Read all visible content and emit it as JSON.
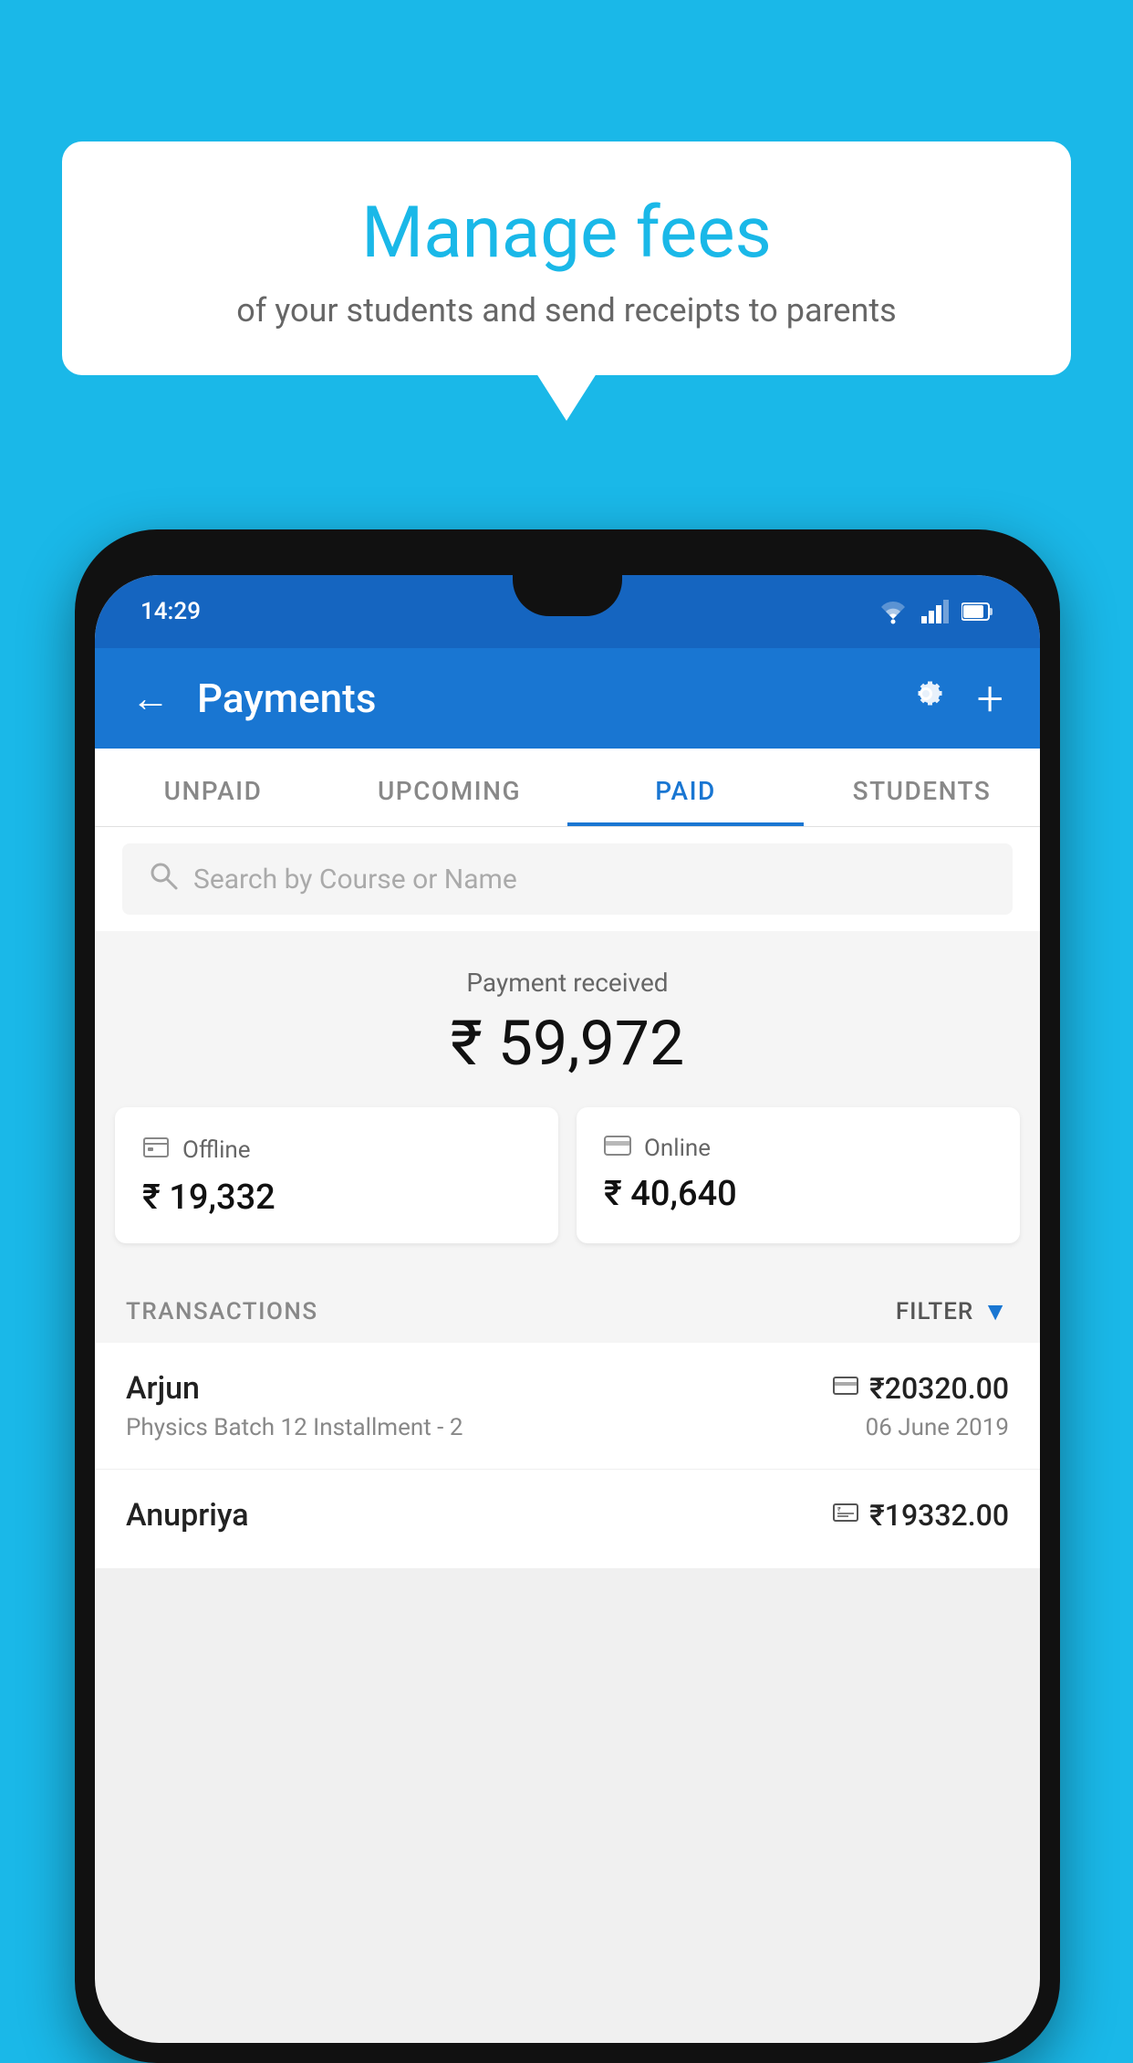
{
  "background_color": "#1ab8e8",
  "bubble": {
    "title": "Manage fees",
    "subtitle": "of your students and send receipts to parents"
  },
  "status_bar": {
    "time": "14:29",
    "icons": [
      "wifi",
      "signal",
      "battery"
    ]
  },
  "top_bar": {
    "title": "Payments",
    "back_icon": "←",
    "settings_icon": "⚙",
    "add_icon": "+"
  },
  "tabs": [
    {
      "label": "UNPAID",
      "active": false
    },
    {
      "label": "UPCOMING",
      "active": false
    },
    {
      "label": "PAID",
      "active": true
    },
    {
      "label": "STUDENTS",
      "active": false
    }
  ],
  "search": {
    "placeholder": "Search by Course or Name"
  },
  "payment_received": {
    "label": "Payment received",
    "amount": "₹ 59,972"
  },
  "payment_cards": [
    {
      "type": "Offline",
      "amount": "₹ 19,332"
    },
    {
      "type": "Online",
      "amount": "₹ 40,640"
    }
  ],
  "transactions": {
    "label": "TRANSACTIONS",
    "filter_label": "FILTER"
  },
  "transaction_rows": [
    {
      "name": "Arjun",
      "description": "Physics Batch 12 Installment - 2",
      "amount": "₹20320.00",
      "date": "06 June 2019",
      "payment_type": "online"
    },
    {
      "name": "Anupriya",
      "description": "",
      "amount": "₹19332.00",
      "date": "",
      "payment_type": "offline"
    }
  ]
}
